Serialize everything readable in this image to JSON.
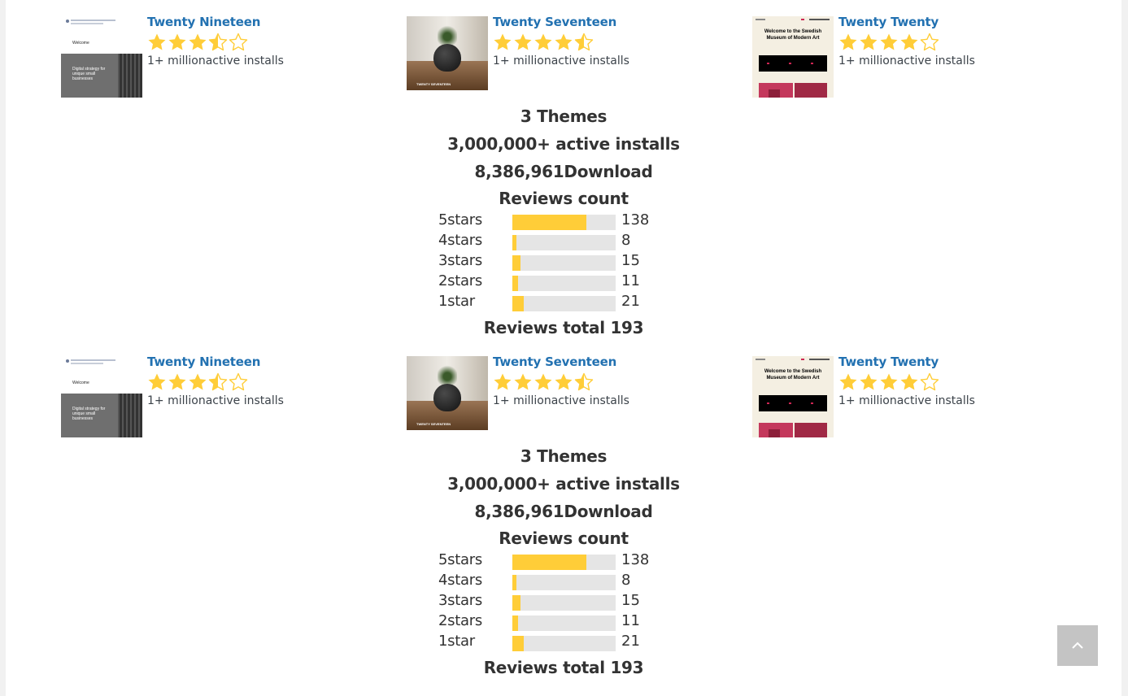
{
  "colors": {
    "star": "#ffcd38",
    "link": "#2271b1",
    "bar_fill": "#ffcd38",
    "bar_empty": "#e5e5e5"
  },
  "blocks": [
    {
      "themes": [
        {
          "name": "Twenty Nineteen",
          "rating": 3.5,
          "installs": "1+ millionactive installs",
          "thumb_text": [
            "Welcome",
            "Digital strategy for unique small businesses"
          ]
        },
        {
          "name": "Twenty Seventeen",
          "rating": 4.5,
          "installs": "1+ millionactive installs",
          "thumb_text": [
            "TWENTY SEVENTEEN"
          ]
        },
        {
          "name": "Twenty Twenty",
          "rating": 4,
          "installs": "1+ millionactive installs",
          "thumb_text": [
            "Welcome to the Swedish Museum of Modern Art"
          ]
        }
      ],
      "summary": {
        "themes_count": "3 Themes",
        "active_installs": "3,000,000+ active installs",
        "downloads": "8,386,961Download",
        "reviews_heading": "Reviews count",
        "reviews_total": "Reviews total 193"
      },
      "reviews": [
        {
          "label": "5stars",
          "count": "138",
          "fraction": 0.715
        },
        {
          "label": "4stars",
          "count": "8",
          "fraction": 0.041
        },
        {
          "label": "3stars",
          "count": "15",
          "fraction": 0.078
        },
        {
          "label": "2stars",
          "count": "11",
          "fraction": 0.057
        },
        {
          "label": "1star",
          "count": "21",
          "fraction": 0.109
        }
      ]
    },
    {
      "themes": [
        {
          "name": "Twenty Nineteen",
          "rating": 3.5,
          "installs": "1+ millionactive installs",
          "thumb_text": [
            "Welcome",
            "Digital strategy for unique small businesses"
          ]
        },
        {
          "name": "Twenty Seventeen",
          "rating": 4.5,
          "installs": "1+ millionactive installs",
          "thumb_text": [
            "TWENTY SEVENTEEN"
          ]
        },
        {
          "name": "Twenty Twenty",
          "rating": 4,
          "installs": "1+ millionactive installs",
          "thumb_text": [
            "Welcome to the Swedish Museum of Modern Art"
          ]
        }
      ],
      "summary": {
        "themes_count": "3 Themes",
        "active_installs": "3,000,000+ active installs",
        "downloads": "8,386,961Download",
        "reviews_heading": "Reviews count",
        "reviews_total": "Reviews total 193"
      },
      "reviews": [
        {
          "label": "5stars",
          "count": "138",
          "fraction": 0.715
        },
        {
          "label": "4stars",
          "count": "8",
          "fraction": 0.041
        },
        {
          "label": "3stars",
          "count": "15",
          "fraction": 0.078
        },
        {
          "label": "2stars",
          "count": "11",
          "fraction": 0.057
        },
        {
          "label": "1star",
          "count": "21",
          "fraction": 0.109
        }
      ]
    }
  ],
  "back_to_top": {
    "icon": "chevron-up-icon"
  }
}
